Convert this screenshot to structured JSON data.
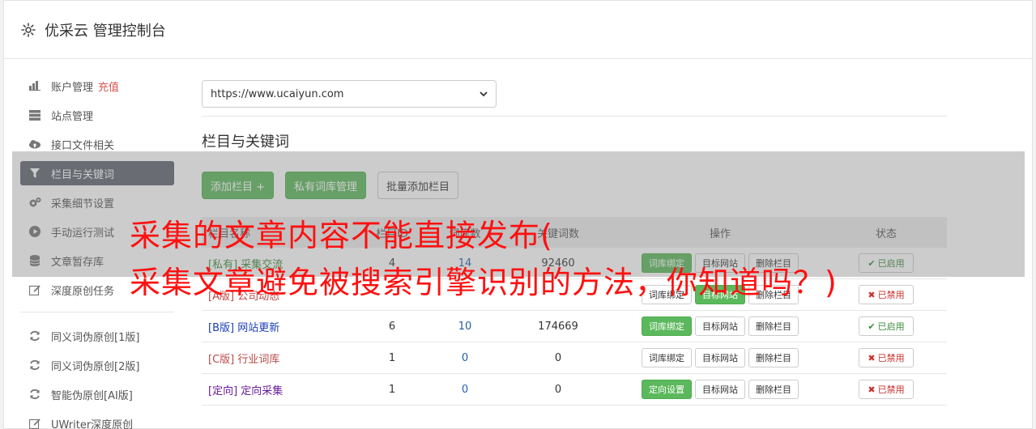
{
  "header": {
    "title": "优采云 管理控制台",
    "icon": "gear-icon"
  },
  "sidebar": {
    "items": [
      {
        "label": "账户管理",
        "badge": "充值",
        "icon": "bar-chart-icon"
      },
      {
        "label": "站点管理",
        "icon": "server-icon"
      },
      {
        "label": "接口文件相关",
        "icon": "cloud-upload-icon"
      },
      {
        "label": "栏目与关键词",
        "icon": "filter-icon",
        "active": true
      },
      {
        "label": "采集细节设置",
        "icon": "cogs-icon"
      },
      {
        "label": "手动运行测试",
        "icon": "play-circle-icon"
      },
      {
        "label": "文章暂存库",
        "icon": "database-icon"
      },
      {
        "label": "深度原创任务",
        "icon": "edit-icon"
      }
    ],
    "items2": [
      {
        "label": "同义词伪原创[1版]",
        "icon": "refresh-icon"
      },
      {
        "label": "同义词伪原创[2版]",
        "icon": "refresh-icon"
      },
      {
        "label": "智能伪原创[AI版]",
        "icon": "refresh-icon"
      },
      {
        "label": "UWriter深度原创",
        "icon": "edit-icon"
      }
    ]
  },
  "main": {
    "site_select": "https://www.ucaiyun.com",
    "section_title": "栏目与关键词",
    "buttons": {
      "add": "添加栏目 +",
      "private": "私有词库管理",
      "batch": "批量添加栏目"
    },
    "table": {
      "headers": [
        "栏目名称",
        "栏目ID",
        "词库数",
        "关键词数",
        "操作",
        "状态"
      ],
      "rows": [
        {
          "prefix": "[私有]",
          "name": "采集交流",
          "id": "4",
          "libs": "14",
          "kw": "92460",
          "op1": "词库绑定",
          "op1_green": true,
          "op2": "目标网站",
          "op3": "删除栏目",
          "status": "已启用",
          "on": true,
          "color": "green"
        },
        {
          "prefix": "[A版]",
          "name": "公司动态",
          "id": "",
          "libs": "",
          "kw": "",
          "op1": "词库绑定",
          "op1_green": false,
          "op2": "目标网站",
          "op3": "删除栏目",
          "status": "已禁用",
          "on": false,
          "color": "red"
        },
        {
          "prefix": "[B版]",
          "name": "网站更新",
          "id": "6",
          "libs": "10",
          "kw": "174669",
          "op1": "词库绑定",
          "op1_green": true,
          "op2": "目标网站",
          "op3": "删除栏目",
          "status": "已启用",
          "on": true,
          "color": "blue"
        },
        {
          "prefix": "[C版]",
          "name": "行业词库",
          "id": "1",
          "libs": "0",
          "kw": "0",
          "op1": "词库绑定",
          "op1_green": false,
          "op2": "目标网站",
          "op3": "删除栏目",
          "status": "已禁用",
          "on": false,
          "color": "red"
        },
        {
          "prefix": "[定向]",
          "name": "定向采集",
          "id": "1",
          "libs": "0",
          "kw": "0",
          "op1": "定向设置",
          "op1_green": true,
          "op2": "目标网站",
          "op3": "删除栏目",
          "status": "已禁用",
          "on": false,
          "color": "purple"
        }
      ]
    }
  },
  "overlay": {
    "line1": "采集的文章内容不能直接发布(",
    "line2": "采集文章避免被搜索引擎识别的方法，你知道吗？)"
  }
}
